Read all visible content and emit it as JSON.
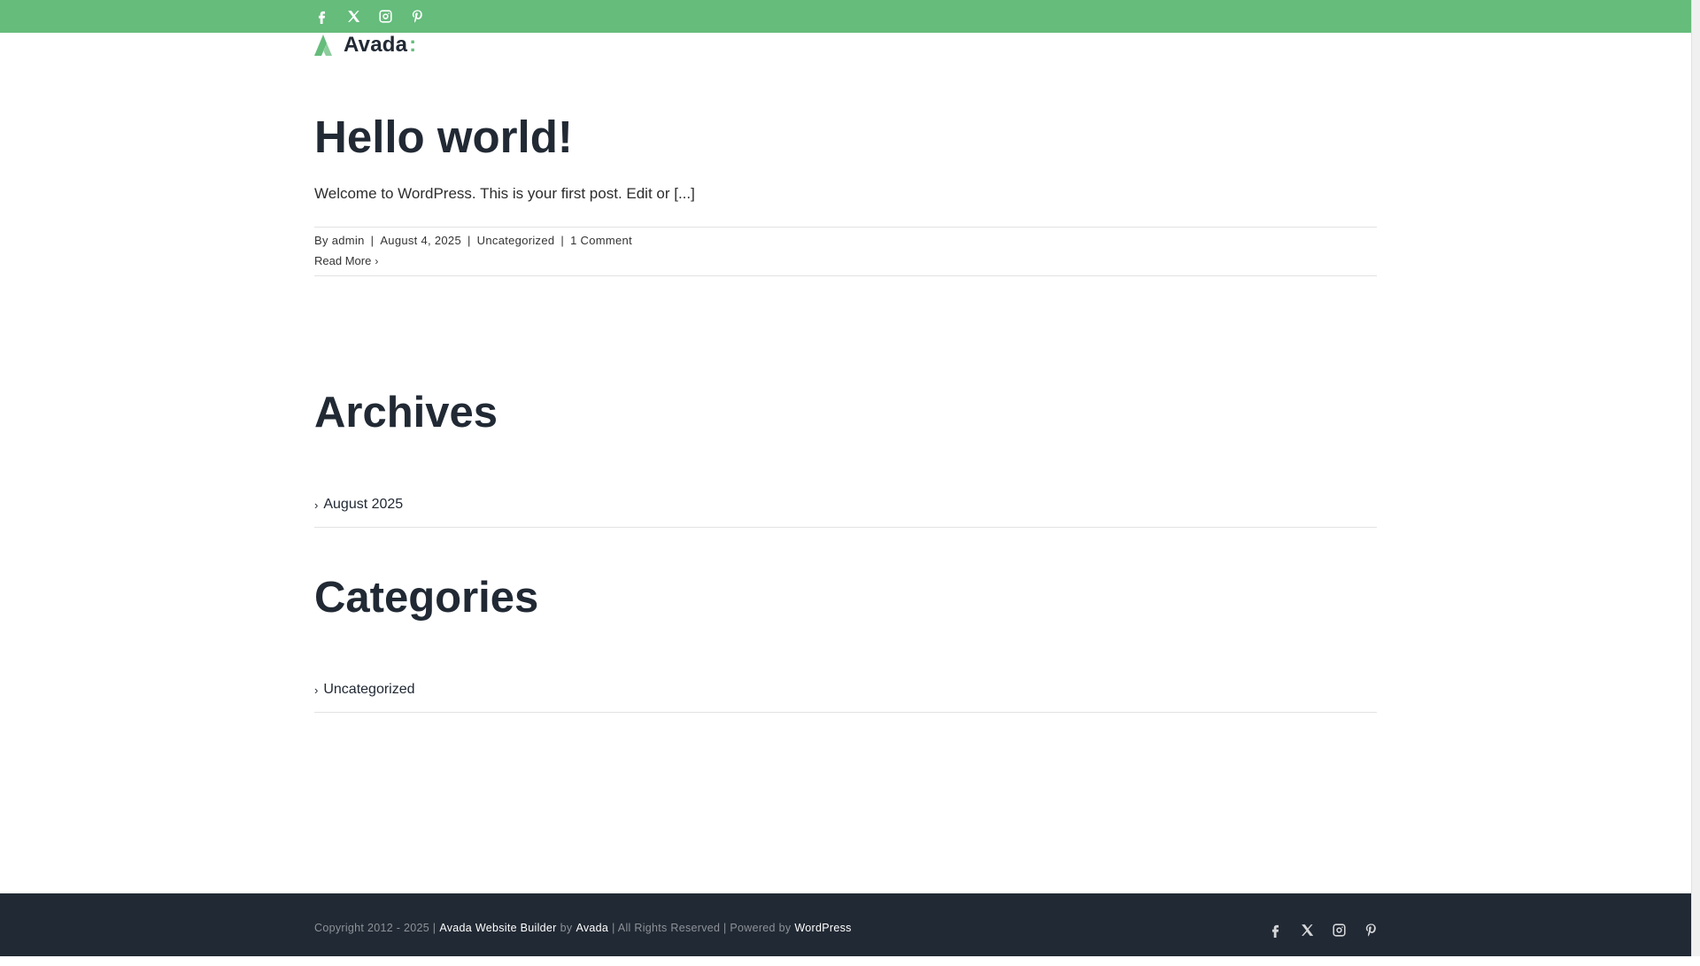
{
  "colors": {
    "accent": "#65bc7b",
    "footer_bg": "#212934",
    "text": "#212934"
  },
  "top_social": [
    {
      "name": "facebook",
      "icon": "facebook-icon"
    },
    {
      "name": "x",
      "icon": "x-icon"
    },
    {
      "name": "instagram",
      "icon": "instagram-icon"
    },
    {
      "name": "pinterest",
      "icon": "pinterest-icon"
    }
  ],
  "logo": {
    "text": "Avada",
    "suffix": ":"
  },
  "post": {
    "title": "Hello world!",
    "excerpt": "Welcome to WordPress. This is your first post. Edit or [...]",
    "meta": {
      "by": "By",
      "author": "admin",
      "sep": "|",
      "date": "August 4, 2025",
      "category": "Uncategorized",
      "comments": "1 Comment"
    },
    "read_more": "Read More",
    "read_more_chevron": "›"
  },
  "archives": {
    "title": "Archives",
    "items": [
      "August 2025"
    ]
  },
  "categories": {
    "title": "Categories",
    "items": [
      "Uncategorized"
    ]
  },
  "list_chevron": "›",
  "footer": {
    "copyright_prefix": "Copyright 2012 - 2025 |",
    "builder_link": "Avada Website Builder",
    "by": "by",
    "avada_link": "Avada",
    "middle": "| All Rights Reserved | Powered by",
    "wp_link": "WordPress"
  }
}
